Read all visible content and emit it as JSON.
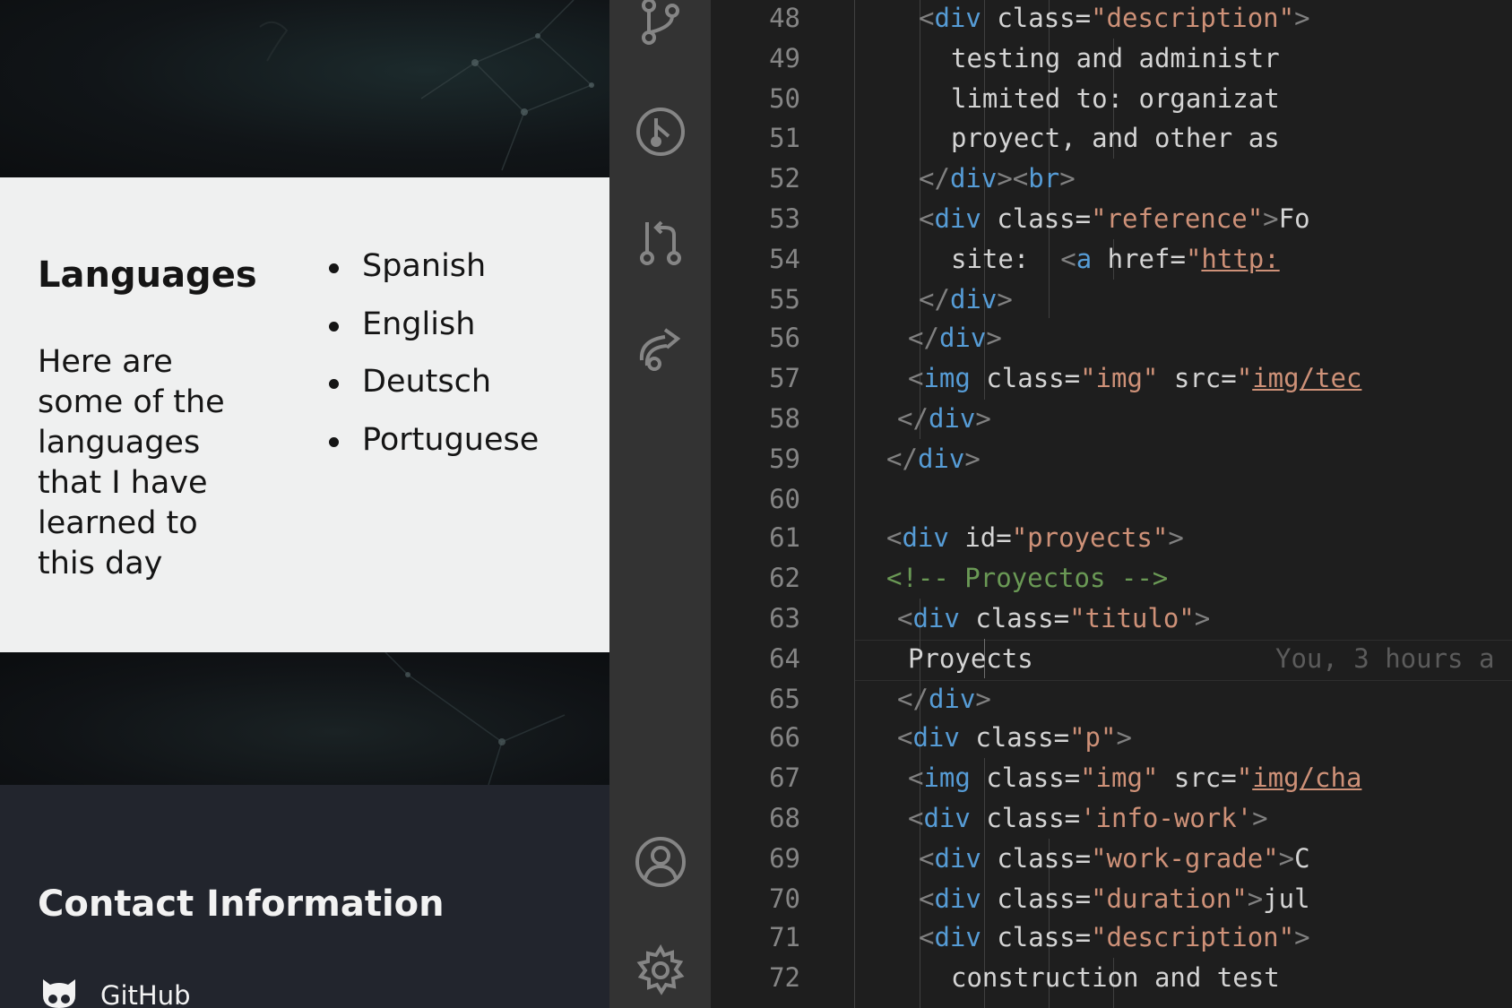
{
  "preview": {
    "languages": {
      "title": "Languages",
      "description": "Here are some of the languages that I have learned to this day",
      "items": [
        "Spanish",
        "English",
        "Deutsch",
        "Portuguese"
      ]
    },
    "contact": {
      "title": "Contact Information",
      "github_label": "GitHub"
    }
  },
  "activity_bar": {
    "icons": [
      "source-control-icon",
      "git-graph-icon",
      "pull-request-icon",
      "remote-share-icon",
      "account-icon",
      "settings-gear-icon"
    ]
  },
  "editor": {
    "line_numbers": [
      "48",
      "49",
      "50",
      "51",
      "52",
      "53",
      "54",
      "55",
      "56",
      "57",
      "58",
      "59",
      "60",
      "61",
      "62",
      "63",
      "64",
      "65",
      "66",
      "67",
      "68",
      "69",
      "70",
      "71",
      "72"
    ],
    "lines": [
      "<div class=\"description\">",
      "testing and administr",
      "limited to: organizat",
      "proyect, and other as",
      "</div><br>",
      "<div class=\"reference\">Fo",
      "site:  <a href=\"http:",
      "</div>",
      "</div>",
      "<img class=\"img\" src=\"img/tec",
      "</div>",
      "</div>",
      "",
      "<div id=\"proyects\">",
      "<!-- Proyectos -->",
      "<div class=\"titulo\">",
      "Proyects",
      "</div>",
      "<div class=\"p\">",
      "<img class=\"img\" src=\"img/cha",
      "<div class='info-work'>",
      "<div class=\"work-grade\">C",
      "<div class=\"duration\">jul",
      "<div class=\"description\">",
      "construction and test"
    ],
    "blame_annotation": "You, 3 hours a",
    "colors": {
      "tag_bracket": "#808080",
      "tag_name": "#569cd6",
      "attribute": "#9cdcfe",
      "string": "#ce9178",
      "comment": "#6a9955",
      "text": "#d4d4d4"
    }
  }
}
